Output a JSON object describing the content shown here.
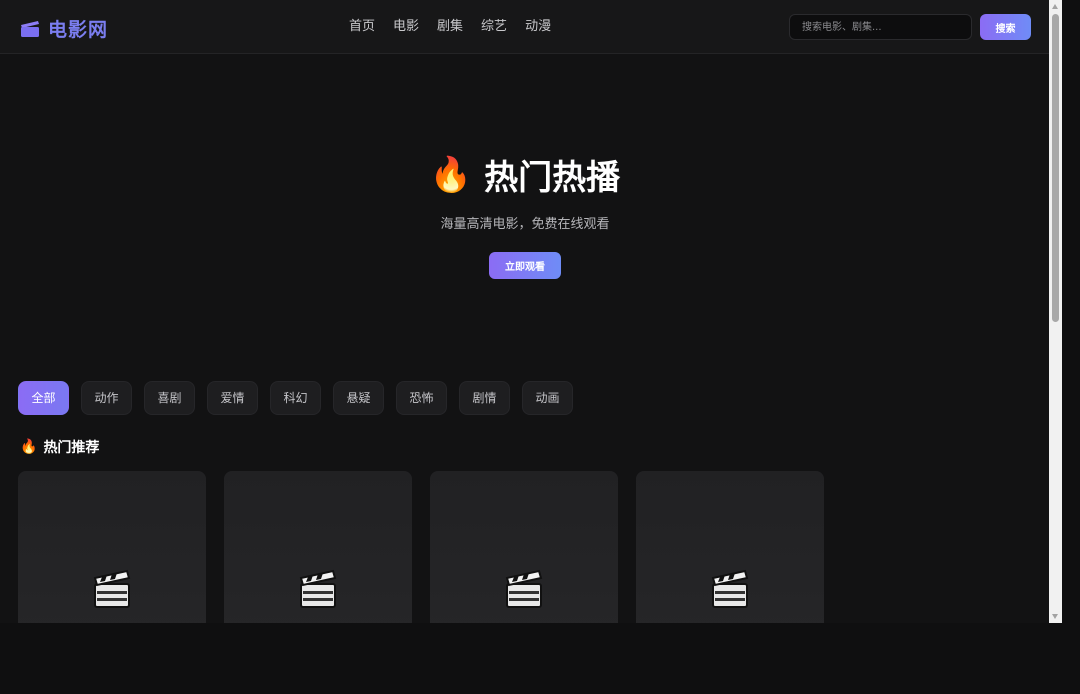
{
  "header": {
    "logo_text": "电影网",
    "logo_icon": "clapper-logo-icon",
    "nav": [
      {
        "label": "首页"
      },
      {
        "label": "电影"
      },
      {
        "label": "剧集"
      },
      {
        "label": "综艺"
      },
      {
        "label": "动漫"
      }
    ],
    "search": {
      "placeholder": "搜索电影、剧集...",
      "value": "",
      "button_label": "搜索"
    }
  },
  "hero": {
    "emoji": "🔥",
    "title": "热门热播",
    "subtitle": "海量高清电影，免费在线观看",
    "button_label": "立即观看"
  },
  "categories": [
    {
      "label": "全部",
      "active": true
    },
    {
      "label": "动作",
      "active": false
    },
    {
      "label": "喜剧",
      "active": false
    },
    {
      "label": "爱情",
      "active": false
    },
    {
      "label": "科幻",
      "active": false
    },
    {
      "label": "悬疑",
      "active": false
    },
    {
      "label": "恐怖",
      "active": false
    },
    {
      "label": "剧情",
      "active": false
    },
    {
      "label": "动画",
      "active": false
    }
  ],
  "section": {
    "emoji": "🔥",
    "title": "热门推荐"
  },
  "cards": [
    {
      "icon": "clapperboard-icon"
    },
    {
      "icon": "clapperboard-icon"
    },
    {
      "icon": "clapperboard-icon"
    },
    {
      "icon": "clapperboard-icon"
    }
  ],
  "colors": {
    "accent_start": "#8b6cf4",
    "accent_end": "#6f8cf6",
    "logo": "#7b7ef0",
    "background": "#121213"
  }
}
